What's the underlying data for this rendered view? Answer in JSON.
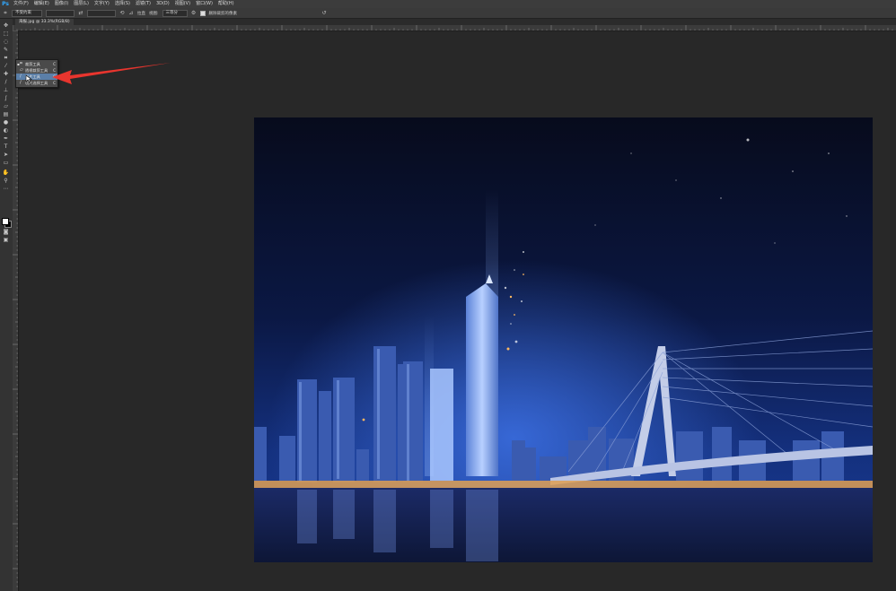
{
  "app": {
    "logo": "Ps",
    "accent": "#31a8ff"
  },
  "menu": [
    "文件(F)",
    "编辑(E)",
    "图像(I)",
    "图层(L)",
    "文字(Y)",
    "选择(S)",
    "滤镜(T)",
    "3D(D)",
    "视图(V)",
    "窗口(W)",
    "帮助(H)"
  ],
  "options": {
    "ratio_select": "不受约束",
    "straighten_label": "拉直",
    "view_label": "视图:",
    "view_select": "三等分",
    "delete_label": "删除裁剪的像素"
  },
  "document_tab": {
    "label": "海报.jpg @ 33.3%(RGB/8)"
  },
  "flyout": {
    "items": [
      {
        "label": "裁剪工具",
        "key": "C",
        "icon": "crop-icon"
      },
      {
        "label": "透视裁剪工具",
        "key": "C",
        "icon": "perspective-crop-icon"
      },
      {
        "label": "切片工具",
        "key": "C",
        "icon": "slice-icon"
      },
      {
        "label": "切片选择工具",
        "key": "C",
        "icon": "slice-select-icon"
      }
    ],
    "active_index": 2,
    "highlight_color": "#5b7fa8"
  },
  "annotation": {
    "arrow_color": "#e8352e"
  }
}
